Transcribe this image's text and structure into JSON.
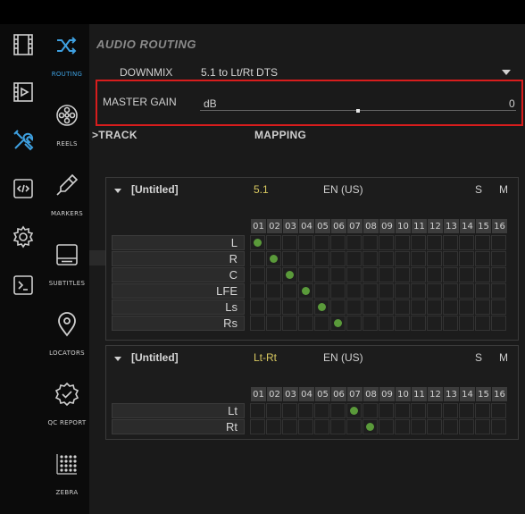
{
  "left_icons": [
    {
      "name": "film-strip-icon"
    },
    {
      "name": "video-player-icon"
    },
    {
      "name": "tools-icon",
      "active": true
    },
    {
      "name": "code-icon"
    },
    {
      "name": "gear-icon"
    },
    {
      "name": "terminal-icon"
    }
  ],
  "nav": [
    {
      "id": "routing",
      "label": "ROUTING",
      "icon": "shuffle-icon",
      "active": true
    },
    {
      "id": "reels",
      "label": "REELS",
      "icon": "film-reel-icon"
    },
    {
      "id": "markers",
      "label": "MARKERS",
      "icon": "marker-pen-icon"
    },
    {
      "id": "subtitles",
      "label": "SUBTITLES",
      "icon": "subtitles-icon"
    },
    {
      "id": "locators",
      "label": "LOCATORS",
      "icon": "map-pin-icon"
    },
    {
      "id": "qc-report",
      "label": "QC REPORT",
      "icon": "badge-check-icon"
    },
    {
      "id": "zebra",
      "label": "ZEBRA",
      "icon": "zebra-grid-icon"
    }
  ],
  "routing": {
    "title": "AUDIO ROUTING",
    "downmix_label": "DOWNMIX",
    "downmix_value": "5.1 to Lt/Rt DTS",
    "master_gain_label": "MASTER GAIN",
    "gain_unit": "dB",
    "gain_value": "0",
    "gain_level": 0.5,
    "track_header": ">TRACK",
    "mapping_header": "MAPPING"
  },
  "columns": [
    "01",
    "02",
    "03",
    "04",
    "05",
    "06",
    "07",
    "08",
    "09",
    "10",
    "11",
    "12",
    "13",
    "14",
    "15",
    "16"
  ],
  "panels": [
    {
      "name": "[Untitled]",
      "format": "5.1",
      "language": "EN (US)",
      "solo": "S",
      "mute": "M",
      "channels": [
        {
          "label": "L",
          "route": 1
        },
        {
          "label": "R",
          "route": 2
        },
        {
          "label": "C",
          "route": 3
        },
        {
          "label": "LFE",
          "route": 4
        },
        {
          "label": "Ls",
          "route": 5
        },
        {
          "label": "Rs",
          "route": 6
        }
      ]
    },
    {
      "name": "[Untitled]",
      "format": "Lt-Rt",
      "language": "EN (US)",
      "solo": "S",
      "mute": "M",
      "channels": [
        {
          "label": "Lt",
          "route": 7
        },
        {
          "label": "Rt",
          "route": 8
        }
      ]
    }
  ],
  "colors": {
    "accent": "#3ea0e0",
    "highlight_box": "#d81d1d",
    "route_dot": "#5a9a3a",
    "format_text": "#d8c860"
  }
}
